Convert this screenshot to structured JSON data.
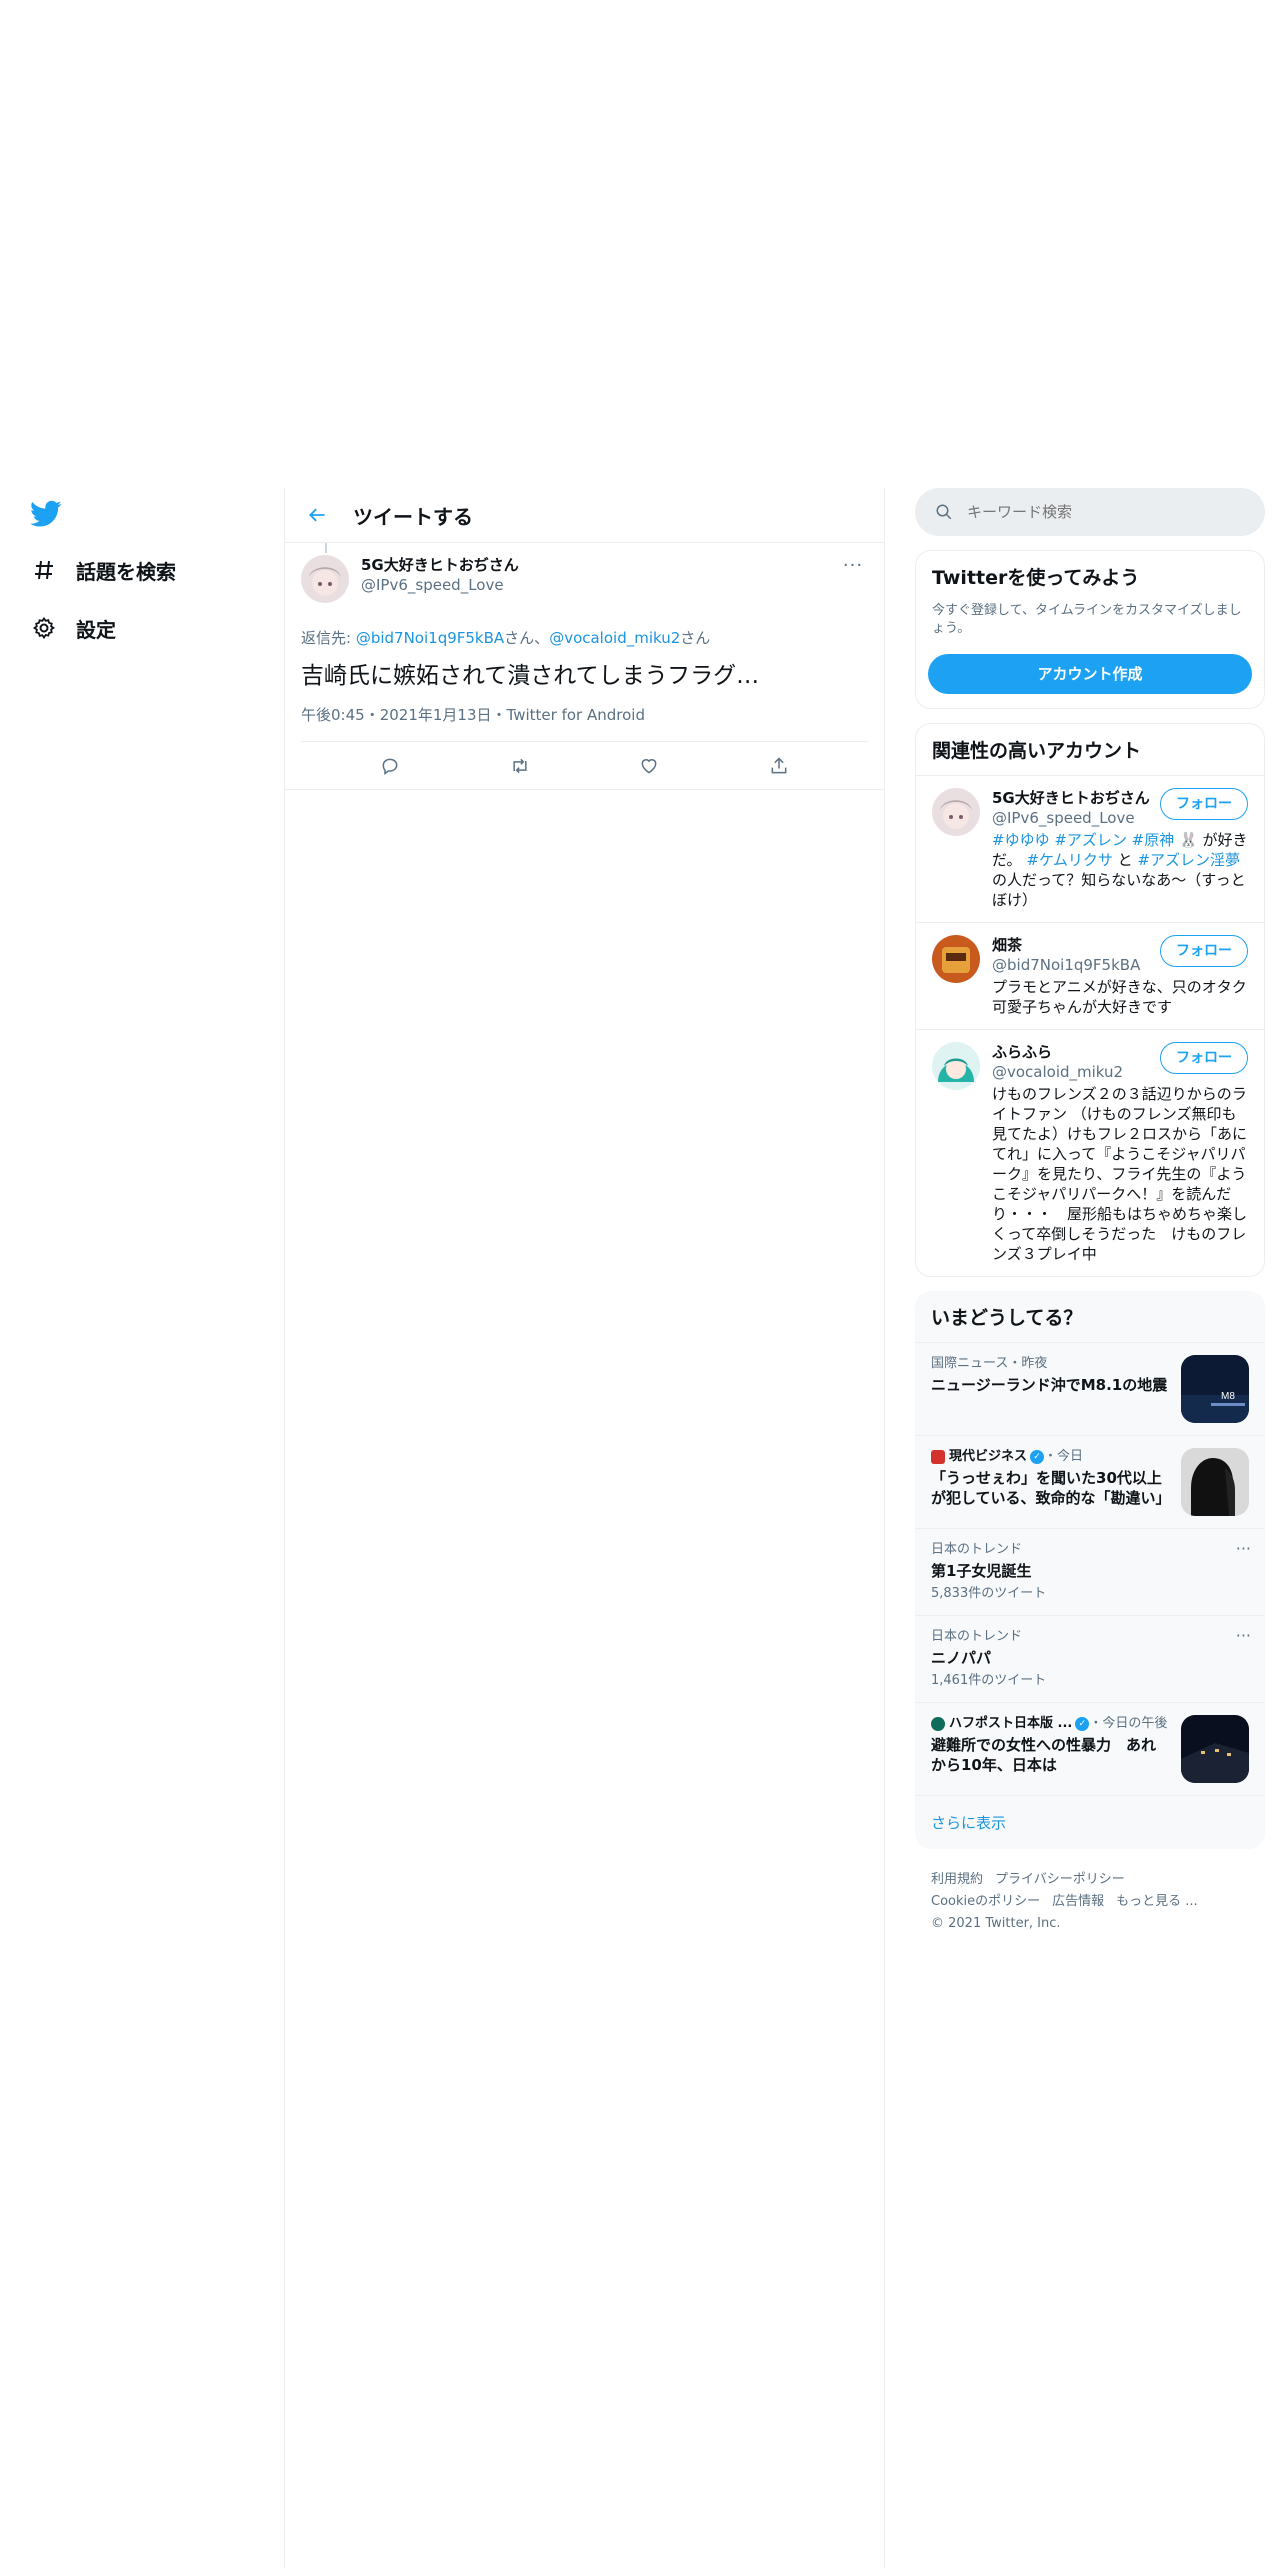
{
  "nav": {
    "items": [
      {
        "label": "話題を検索"
      },
      {
        "label": "設定"
      }
    ]
  },
  "main": {
    "title": "ツイートする",
    "tweet": {
      "name": "5G大好きヒトおぢさん",
      "handle": "@IPv6_speed_Love",
      "reply_prefix": "返信先: ",
      "reply_user1": "@bid7Noi1q9F5kBA",
      "reply_suffix1": "さん、",
      "reply_user2": "@vocaloid_miku2",
      "reply_suffix2": "さん",
      "text": "吉崎氏に嫉妬されて潰されてしまうフラグ…",
      "time": "午後0:45",
      "date": "2021年1月13日",
      "client": "Twitter for Android",
      "sep": "・"
    }
  },
  "search": {
    "placeholder": "キーワード検索"
  },
  "signup": {
    "title": "Twitterを使ってみよう",
    "desc": "今すぐ登録して、タイムラインをカスタマイズしましょう。",
    "button": "アカウント作成"
  },
  "relevant": {
    "title": "関連性の高いアカウント",
    "follow_label": "フォロー",
    "accounts": [
      {
        "name": "5G大好きヒトおぢさん",
        "handle": "@IPv6_speed_Love",
        "bio_parts": [
          "#ゆゆゆ #アズレン #原神",
          " 🐰 が好きだ。 ",
          "#ケムリクサ",
          " と ",
          "#アズレン淫夢",
          " の人だって？知らないなあ〜（すっとぼけ）"
        ]
      },
      {
        "name": "畑茶",
        "handle": "@bid7Noi1q9F5kBA",
        "bio": "プラモとアニメが好きな、只のオタク 可愛子ちゃんが大好きです"
      },
      {
        "name": "ふらふら",
        "handle": "@vocaloid_miku2",
        "bio": "けものフレンズ２の３話辺りからのライトファン （けものフレンズ無印も見てたよ）けもフレ２ロスから「あにてれ」に入って『ようこそジャパリパーク』を見たり、フライ先生の『ようこそジャパリパークへ！』を読んだり・・・　屋形船もはちゃめちゃ楽しくって卒倒しそうだった　けものフレンズ３プレイ中"
      }
    ]
  },
  "trends": {
    "title": "いまどうしてる？",
    "items": [
      {
        "category": "国際ニュース・昨夜",
        "title": "ニュージーランド沖でM8.1の地震",
        "image": "earthquake-news-thumbnail"
      },
      {
        "source": "現代ビジネス",
        "time": "・今日",
        "title": "「うっせぇわ」を聞いた30代以上が犯している、致命的な「勘違い」",
        "image": "silhouette-thumbnail"
      },
      {
        "category": "日本のトレンド",
        "title": "第1子女児誕生",
        "count": "5,833件のツイート"
      },
      {
        "category": "日本のトレンド",
        "title": "ニノパパ",
        "count": "1,461件のツイート"
      },
      {
        "source": "ハフポスト日本版 ...",
        "time": "・今日の午後",
        "title": "避難所での女性への性暴力　あれから10年、日本は",
        "image": "night-building-thumbnail"
      }
    ],
    "show_more": "さらに表示"
  },
  "footer": {
    "links": [
      "利用規約",
      "プライバシーポリシー",
      "Cookieのポリシー",
      "広告情報",
      "もっと見る ..."
    ],
    "copyright": "© 2021 Twitter, Inc."
  },
  "colors": {
    "accent": "#1da1f2",
    "link": "#1b95e0",
    "muted": "#5b7083"
  }
}
